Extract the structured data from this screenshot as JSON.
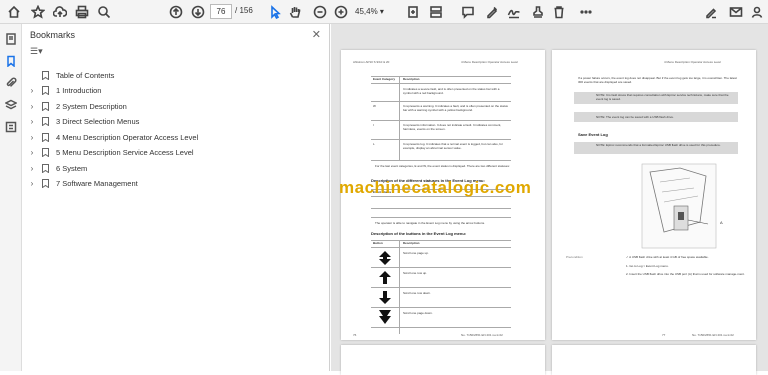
{
  "toolbar": {
    "current_page": "76",
    "total_pages": "/ 156",
    "zoom": "45,4%",
    "zoom_arrow": "▾"
  },
  "bookmarks": {
    "title": "Bookmarks",
    "close": "✕",
    "menu": "☰▾",
    "items": [
      {
        "label": "Table of Contents",
        "expandable": false
      },
      {
        "label": "1 Introduction",
        "expandable": true
      },
      {
        "label": "2 System Description",
        "expandable": true
      },
      {
        "label": "3 Direct Selection Menus",
        "expandable": true
      },
      {
        "label": "4 Menu Description Operator Access Level",
        "expandable": true
      },
      {
        "label": "5 Menu Description Service Access Level",
        "expandable": true
      },
      {
        "label": "6 System",
        "expandable": true
      },
      {
        "label": "7 Software Management",
        "expandable": true
      }
    ]
  },
  "watermark": "machinecatalogic.com",
  "page_left": {
    "header_left": "Ahlstrom AP10 S 9/10 & 20",
    "header_right": "4 Menu Description Operator Access Level",
    "col1": "Event Category",
    "col2": "Description",
    "rows": [
      {
        "cat": "",
        "desc": "It indicates a severe fault, and is often presented on the status bar with a symbol with a red background."
      },
      {
        "cat": "W",
        "desc": "It represents a warning. It indicates a fault, and is often presented on the status bar with a warning symbol with a yellow background."
      },
      {
        "cat": "I",
        "desc": "It represents information. It does not indicate a fault. It indicates comment, harmless, events on the screen."
      },
      {
        "cat": "L",
        "desc": "It represents log. It indicates that a normal event is logged, but can also, for example, display an abnormal sensor value."
      }
    ],
    "note": "For the last event categories, E and W, the event status is displayed. There are two different statuses:",
    "heading1": "Description of the different statuses in the Event Log menu:",
    "status_col": "Event Status",
    "heading2": "Description of the buttons in the Event Log menu:",
    "navigate_note": "The operator is able to navigate in the Event Log menu by using the arrow buttons.",
    "btn_col": "Button",
    "btn_col2": "Description",
    "buttons": [
      "Scroll one page up.",
      "Scroll one row up.",
      "Scroll one row down.",
      "Scroll one page down.",
      "Save data."
    ],
    "footer_left": "76",
    "footer_right": "No. 7150/2651 EN 201 rev.k.02"
  },
  "page_right": {
    "header_right": "4 Menu Description Operator Access Level",
    "intro": "If a power failure occurs, the event log does not disappear. But if the event log gets too large, it is overwritten. The latest 300 events that are displayed are saved.",
    "note1": "NOTE: It is fault stress that requires consultation with Epiroc service technicians, make sure that the event log is saved.",
    "note2": "NOTE: The event log can be saved with a USB flash drive.",
    "heading": "Save Event Log",
    "note3": "NOTE: Epiroc recommends that a formatted Epiroc USB flash drive is used for this procedure.",
    "figure_label": "A",
    "precondition": "Precondition",
    "precondition_text": "✓ A USB flash drive with at least 4 GB of free space available.",
    "step1": "1.  Go to Log > Event Log menu.",
    "step2": "2.  Insert the USB flash drive into the USB port (A) that is used for software manage-ment.",
    "footer_left": "77",
    "footer_right": "No. 7150/2651 EN 201 rev.k.02"
  },
  "colors": {
    "toolbar_bg": "#f4f4f4",
    "doc_bg": "#e4e4e4",
    "watermark": "#e0a800",
    "accent_blue": "#1a73e8"
  }
}
